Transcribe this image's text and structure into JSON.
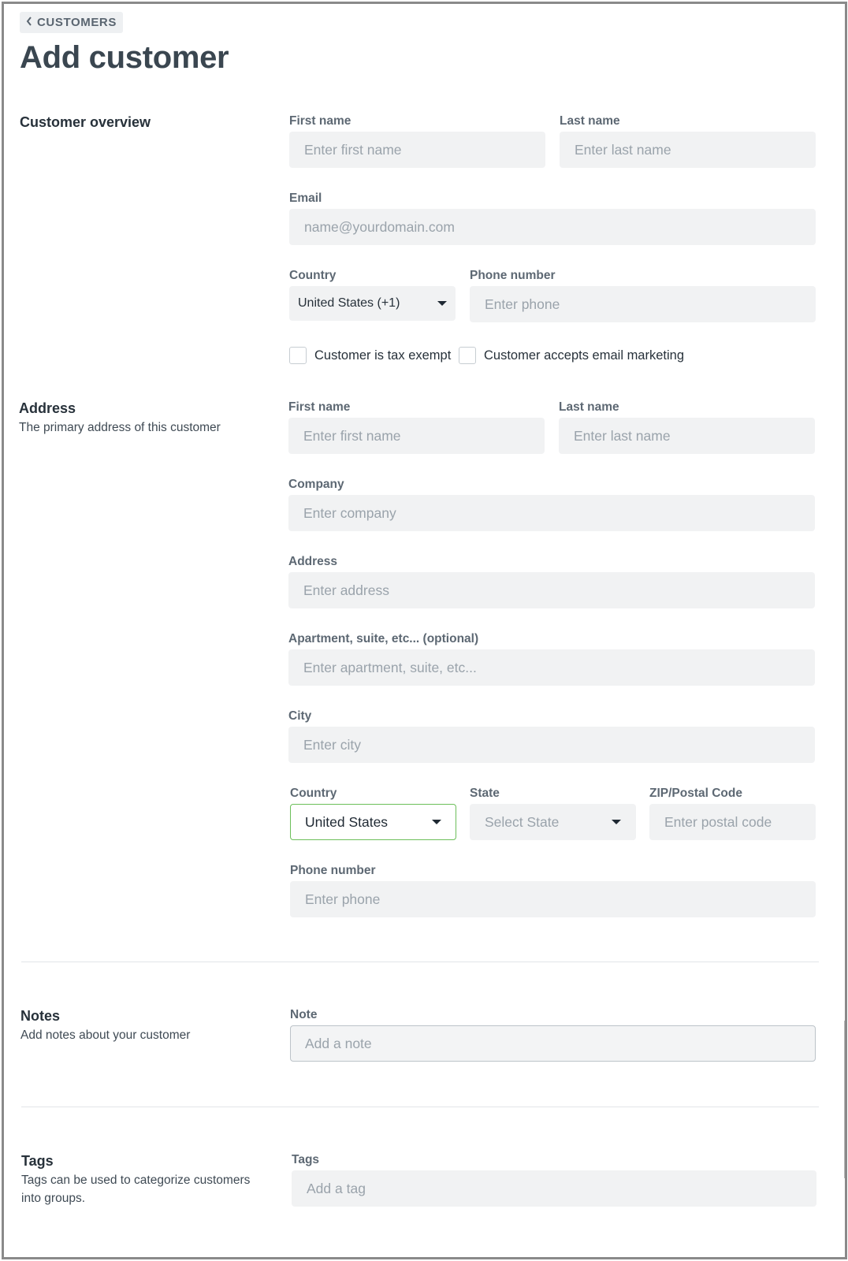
{
  "header": {
    "back_label": "CUSTOMERS",
    "title": "Add customer"
  },
  "overview": {
    "title": "Customer overview",
    "first_name_label": "First name",
    "first_name_placeholder": "Enter first name",
    "last_name_label": "Last name",
    "last_name_placeholder": "Enter last name",
    "email_label": "Email",
    "email_placeholder": "name@yourdomain.com",
    "country_label": "Country",
    "country_value": "United States (+1)",
    "phone_label": "Phone number",
    "phone_placeholder": "Enter phone",
    "tax_exempt_label": "Customer is tax exempt",
    "email_marketing_label": "Customer accepts email marketing"
  },
  "address": {
    "title": "Address",
    "description": "The primary address of this customer",
    "first_name_label": "First name",
    "first_name_placeholder": "Enter first name",
    "last_name_label": "Last name",
    "last_name_placeholder": "Enter last name",
    "company_label": "Company",
    "company_placeholder": "Enter company",
    "address_label": "Address",
    "address_placeholder": "Enter address",
    "apartment_label": "Apartment, suite, etc... (optional)",
    "apartment_placeholder": "Enter apartment, suite, etc...",
    "city_label": "City",
    "city_placeholder": "Enter city",
    "country_label": "Country",
    "country_value": "United States",
    "state_label": "State",
    "state_placeholder": "Select State",
    "zip_label": "ZIP/Postal Code",
    "zip_placeholder": "Enter postal code",
    "phone_label": "Phone number",
    "phone_placeholder": "Enter phone"
  },
  "notes": {
    "title": "Notes",
    "description": "Add notes about your customer",
    "note_label": "Note",
    "note_placeholder": "Add a note"
  },
  "tags": {
    "title": "Tags",
    "description_line1": "Tags can be used to categorize customers",
    "description_line2": "into groups.",
    "tags_label": "Tags",
    "tags_placeholder": "Add a tag"
  },
  "colors": {
    "focus_border": "#6cbf5a",
    "input_bg": "#f1f2f3",
    "title": "#3a4650"
  },
  "icons": {
    "back": "chevron-left-icon",
    "dropdown": "caret-down-icon"
  }
}
